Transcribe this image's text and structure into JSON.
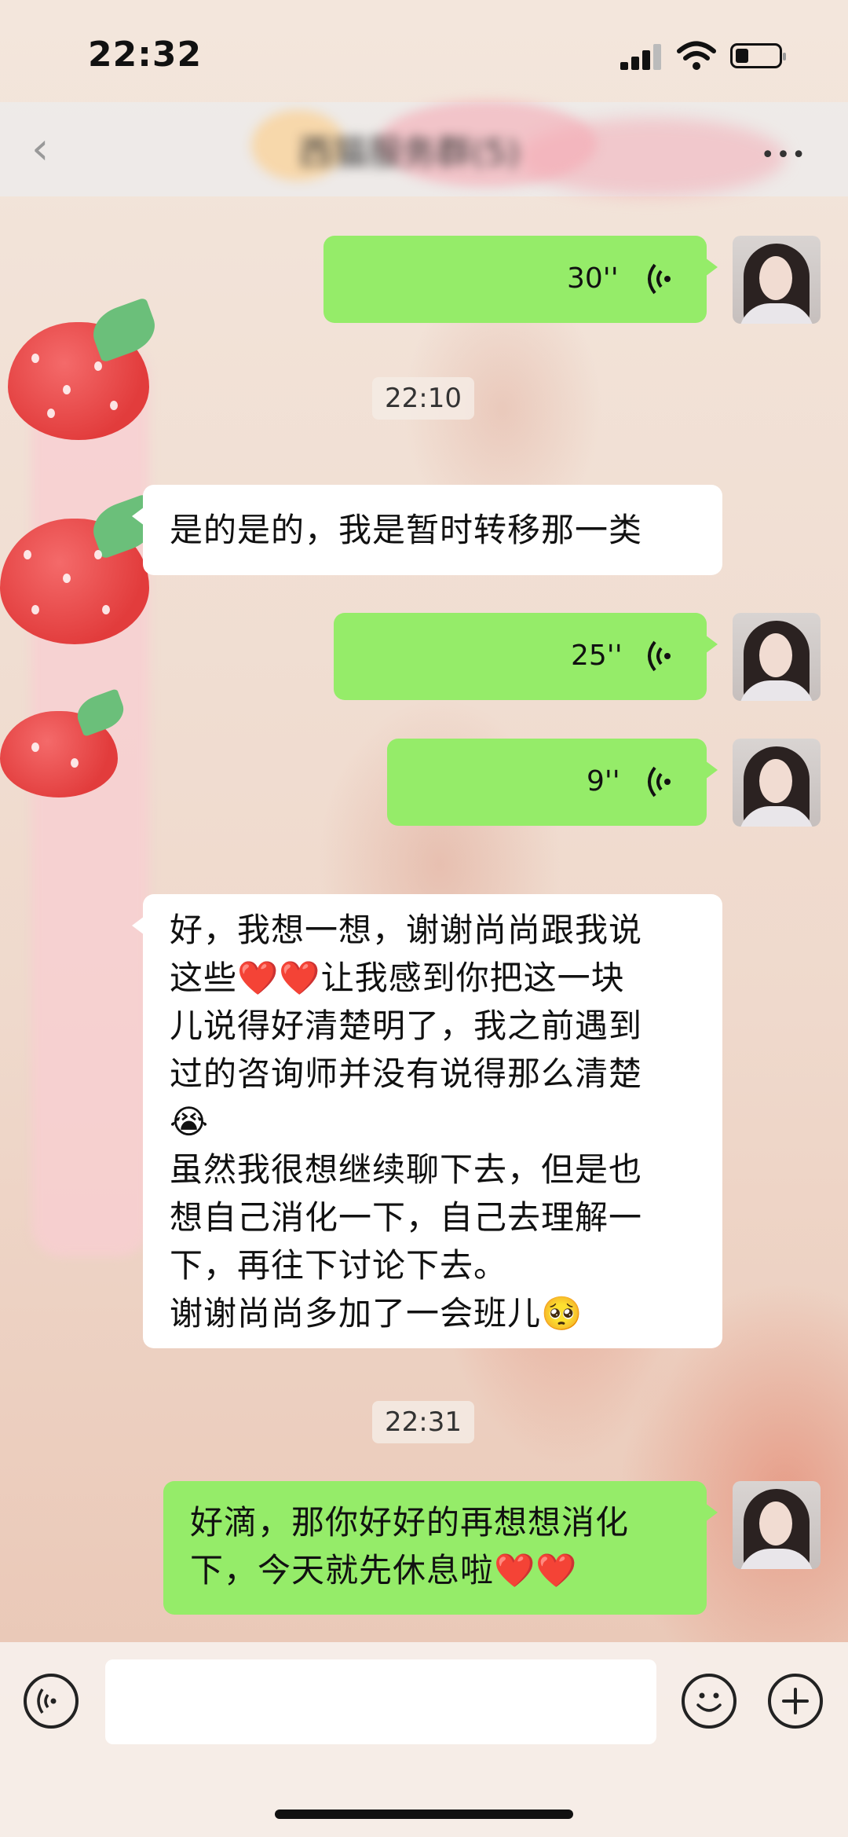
{
  "status_bar": {
    "time": "22:32"
  },
  "nav": {
    "back_glyph": "‹",
    "title": "西猫服务群(5)",
    "more_glyph": "•••"
  },
  "messages": [
    {
      "id": "m1",
      "side": "right",
      "type": "voice",
      "duration": "30''"
    },
    {
      "id": "t1",
      "type": "timestamp",
      "text": "22:10"
    },
    {
      "id": "m2",
      "side": "left",
      "type": "text",
      "lines": [
        "是的是的，我是暂时转移那一类"
      ]
    },
    {
      "id": "m3",
      "side": "right",
      "type": "voice",
      "duration": "25''"
    },
    {
      "id": "m4",
      "side": "right",
      "type": "voice",
      "duration": "9''"
    },
    {
      "id": "m5",
      "side": "left",
      "type": "text",
      "lines": [
        "好，我想一想，谢谢尚尚跟我说",
        "这些❤️❤️让我感到你把这一块",
        "儿说得好清楚明了，我之前遇到",
        "过的咨询师并没有说得那么清楚",
        "😭",
        "虽然我很想继续聊下去，但是也",
        "想自己消化一下，自己去理解一",
        "下，再往下讨论下去。",
        "谢谢尚尚多加了一会班儿🥺"
      ]
    },
    {
      "id": "t2",
      "type": "timestamp",
      "text": "22:31"
    },
    {
      "id": "m6",
      "side": "right",
      "type": "text",
      "lines": [
        "好滴，那你好好的再想想消化",
        "下，今天就先休息啦❤️❤️"
      ]
    }
  ],
  "input_bar": {
    "placeholder": "",
    "voice_icon": "voice-mode-icon",
    "emoji_icon": "emoji-icon",
    "plus_icon": "plus-icon"
  },
  "colors": {
    "bubble_green": "#95ec69",
    "bubble_white": "#ffffff",
    "heart": "#ef4d6a"
  }
}
